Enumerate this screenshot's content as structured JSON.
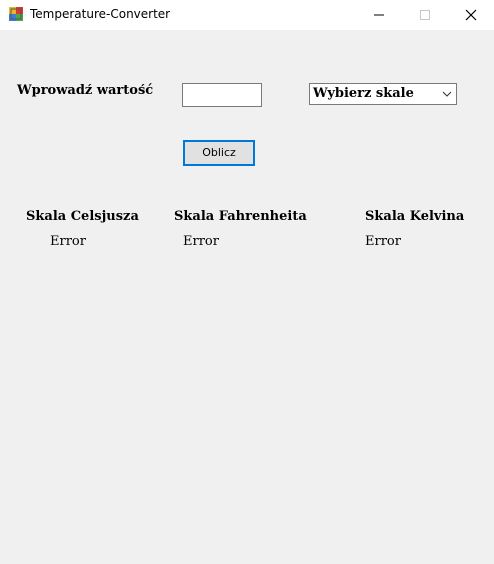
{
  "window": {
    "title": "Temperature-Converter",
    "icon": "app-icon"
  },
  "form": {
    "input_label": "Wprowadź wartość",
    "input_value": "",
    "scale_select": {
      "selected": "Wybierz skale"
    },
    "calculate_button": "Oblicz"
  },
  "results": {
    "celsius": {
      "label": "Skala Celsjusza",
      "value": "Error"
    },
    "fahrenheit": {
      "label": "Skala Fahrenheita",
      "value": "Error"
    },
    "kelvin": {
      "label": "Skala Kelvina",
      "value": "Error"
    }
  },
  "colors": {
    "accent": "#0078d7",
    "background": "#f0f0f0",
    "titlebar": "#ffffff"
  }
}
